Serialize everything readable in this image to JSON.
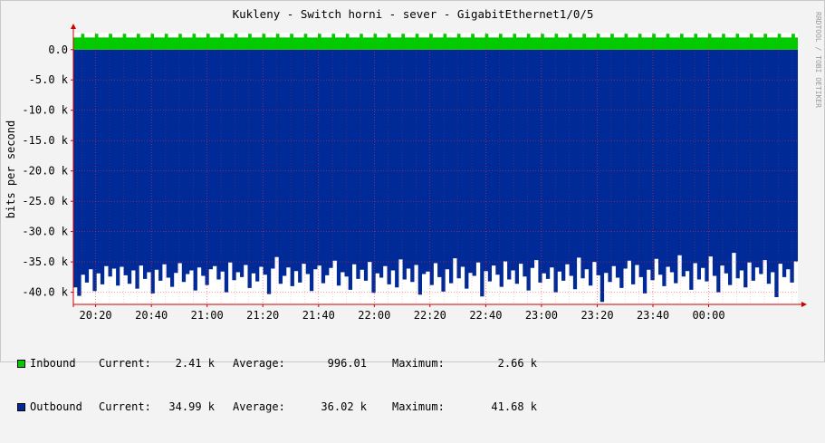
{
  "chart_data": {
    "type": "area",
    "title": "Kukleny - Switch horni - sever - GigabitEthernet1/0/5",
    "ylabel": "bits per second",
    "watermark": "RRDTOOL / TOBI OETIKER",
    "ylim": [
      -42000,
      2800
    ],
    "yticks": [
      {
        "value": 0,
        "label": "0.0"
      },
      {
        "value": -5000,
        "label": "-5.0 k"
      },
      {
        "value": -10000,
        "label": "-10.0 k"
      },
      {
        "value": -15000,
        "label": "-15.0 k"
      },
      {
        "value": -20000,
        "label": "-20.0 k"
      },
      {
        "value": -25000,
        "label": "-25.0 k"
      },
      {
        "value": -30000,
        "label": "-30.0 k"
      },
      {
        "value": -35000,
        "label": "-35.0 k"
      },
      {
        "value": -40000,
        "label": "-40.0 k"
      }
    ],
    "xrange": [
      "20:12",
      "00:32"
    ],
    "xticks": [
      "20:20",
      "20:40",
      "21:00",
      "21:20",
      "21:40",
      "22:00",
      "22:20",
      "22:40",
      "23:00",
      "23:20",
      "23:40",
      "00:00"
    ],
    "series": [
      {
        "name": "Inbound",
        "color": "#00cc00",
        "baseline": 2000,
        "peak": 2600,
        "period_min": 5,
        "current": "2.41 k",
        "average": "996.01",
        "maximum": "2.66 k"
      },
      {
        "name": "Outbound",
        "color": "#002a97",
        "values": [
          -39200,
          -40600,
          -37100,
          -38400,
          -36200,
          -39800,
          -36900,
          -38700,
          -35700,
          -37400,
          -36100,
          -38900,
          -35800,
          -37200,
          -38600,
          -36400,
          -39400,
          -35600,
          -37800,
          -36700,
          -40200,
          -36300,
          -38100,
          -35400,
          -37600,
          -39100,
          -36800,
          -35200,
          -38300,
          -37000,
          -36400,
          -39700,
          -35900,
          -37300,
          -38800,
          -36200,
          -35700,
          -37900,
          -36600,
          -40000,
          -35100,
          -38000,
          -36700,
          -37500,
          -35500,
          -39300,
          -36900,
          -38200,
          -35800,
          -37100,
          -40300,
          -36100,
          -34200,
          -38600,
          -37300,
          -35900,
          -39000,
          -36500,
          -38400,
          -35300,
          -37000,
          -39800,
          -36200,
          -35600,
          -38500,
          -37200,
          -36000,
          -34800,
          -38900,
          -36700,
          -37400,
          -39600,
          -35400,
          -37800,
          -36300,
          -38100,
          -35000,
          -40100,
          -36900,
          -37600,
          -35700,
          -38700,
          -36400,
          -39200,
          -34600,
          -37900,
          -36100,
          -38300,
          -35500,
          -40400,
          -37000,
          -36600,
          -38800,
          -35200,
          -37500,
          -39900,
          -36200,
          -38500,
          -34400,
          -37700,
          -35800,
          -39400,
          -36800,
          -37300,
          -35100,
          -40700,
          -36500,
          -38200,
          -35600,
          -37100,
          -39100,
          -34900,
          -37900,
          -36400,
          -38600,
          -35300,
          -37400,
          -39700,
          -36000,
          -34700,
          -38400,
          -36900,
          -37800,
          -35900,
          -40000,
          -36600,
          -38100,
          -35400,
          -37300,
          -39500,
          -34300,
          -37700,
          -36200,
          -38900,
          -35000,
          -37200,
          -41600,
          -36800,
          -38300,
          -35700,
          -37600,
          -39300,
          -36100,
          -34800,
          -38700,
          -35500,
          -37500,
          -40200,
          -36300,
          -38000,
          -34500,
          -37100,
          -39000,
          -35800,
          -36700,
          -38500,
          -33900,
          -37400,
          -36500,
          -39600,
          -35200,
          -37900,
          -36000,
          -38200,
          -34100,
          -37300,
          -40000,
          -35600,
          -36900,
          -38800,
          -33500,
          -37700,
          -36400,
          -39200,
          -35100,
          -38100,
          -35900,
          -37000,
          -34700,
          -38600,
          -36700,
          -40800,
          -35300,
          -37500,
          -36200,
          -38400,
          -34900
        ],
        "current": "34.99 k",
        "average": "36.02 k",
        "maximum": "41.68 k"
      }
    ],
    "grid": true
  },
  "legend": {
    "current_label": "Current:",
    "average_label": "Average:",
    "maximum_label": "Maximum:",
    "inbound_color": "#00cc00",
    "outbound_color": "#002a97"
  }
}
